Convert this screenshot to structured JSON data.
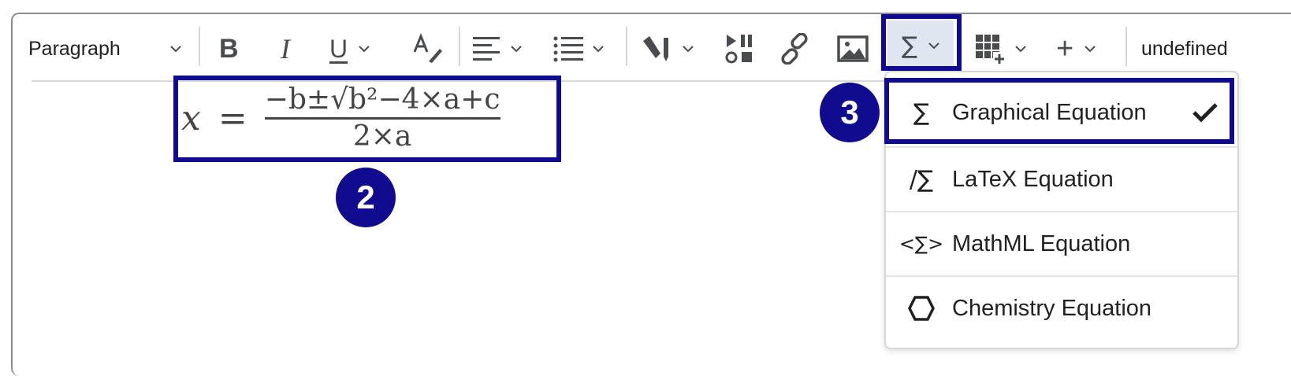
{
  "toolbar": {
    "paragraph_label": "Paragraph",
    "bold_glyph": "B",
    "italic_glyph": "I",
    "underline_glyph": "U",
    "sigma_glyph": "∑",
    "plus_glyph": "+",
    "overflow_label": "undefined"
  },
  "equation": {
    "lhs": "x",
    "eq": "=",
    "numerator": "−b±√b²−4×a+c",
    "denominator": "2×a"
  },
  "callouts": {
    "two": "2",
    "three": "3"
  },
  "equation_menu": {
    "items": [
      {
        "icon": "∑",
        "label": "Graphical Equation",
        "selected": true
      },
      {
        "icon": "/∑",
        "label": "LaTeX Equation",
        "selected": false
      },
      {
        "icon": "<∑>",
        "label": "MathML Equation",
        "selected": false
      },
      {
        "icon": "hexagon",
        "label": "Chemistry Equation",
        "selected": false
      }
    ]
  },
  "colors": {
    "highlight": "#100b8f",
    "active_button_bg": "#dfe6ef",
    "icon": "#494c4e"
  }
}
